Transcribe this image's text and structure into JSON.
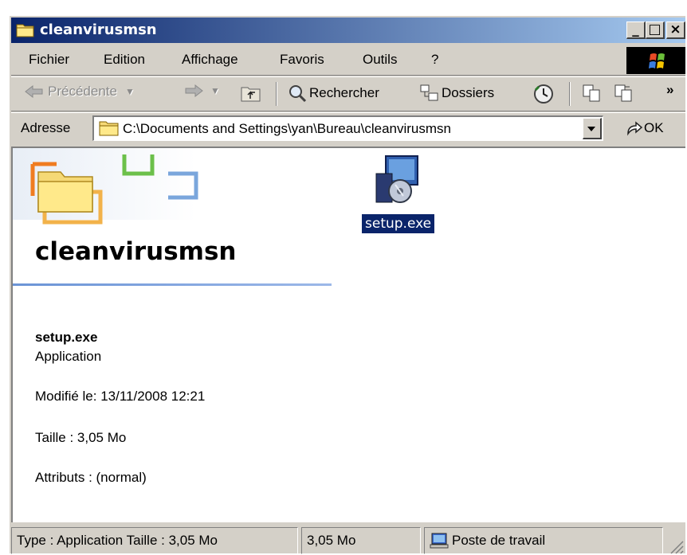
{
  "window": {
    "title": "cleanvirusmsn",
    "controls": {
      "minimize": "_",
      "maximize": "□",
      "close": "×"
    }
  },
  "menu": {
    "items": [
      "Fichier",
      "Edition",
      "Affichage",
      "Favoris",
      "Outils",
      "?"
    ]
  },
  "toolbar": {
    "back_label": "Précédente",
    "search_label": "Rechercher",
    "folders_label": "Dossiers",
    "overflow": "»"
  },
  "address": {
    "label": "Adresse",
    "path": "C:\\Documents and Settings\\yan\\Bureau\\cleanvirusmsn",
    "go_label": "OK"
  },
  "sidepanel": {
    "folder_name": "cleanvirusmsn",
    "selected_name": "setup.exe",
    "selected_type": "Application",
    "modified": "Modifié le: 13/11/2008 12:21",
    "size": "Taille : 3,05 Mo",
    "attributes": "Attributs : (normal)"
  },
  "files": [
    {
      "name": "setup.exe"
    }
  ],
  "status": {
    "type_text": "Type : Application Taille  : 3,05 Mo",
    "size_text": "3,05 Mo",
    "zone_text": "Poste de travail"
  },
  "colors": {
    "titlebar_start": "#0a246a",
    "titlebar_end": "#a6caf0",
    "selection": "#0a246a",
    "face": "#d4d0c8"
  }
}
